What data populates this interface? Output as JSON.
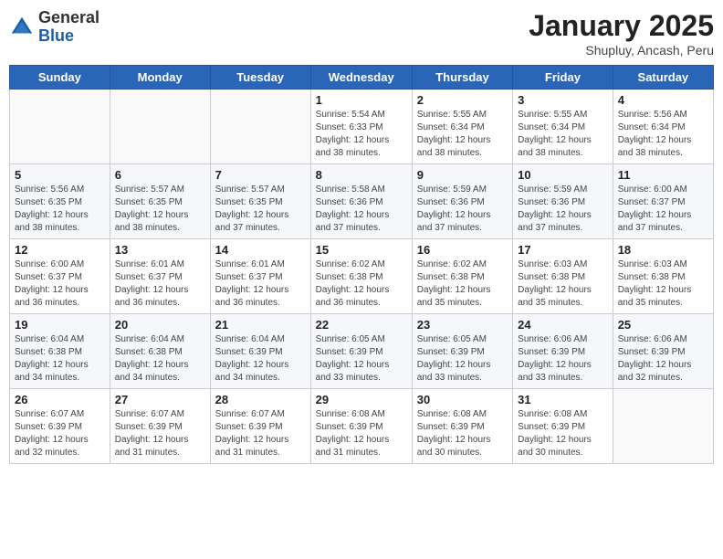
{
  "header": {
    "logo_general": "General",
    "logo_blue": "Blue",
    "month_year": "January 2025",
    "location": "Shupluy, Ancash, Peru"
  },
  "weekdays": [
    "Sunday",
    "Monday",
    "Tuesday",
    "Wednesday",
    "Thursday",
    "Friday",
    "Saturday"
  ],
  "weeks": [
    [
      {
        "day": "",
        "info": ""
      },
      {
        "day": "",
        "info": ""
      },
      {
        "day": "",
        "info": ""
      },
      {
        "day": "1",
        "info": "Sunrise: 5:54 AM\nSunset: 6:33 PM\nDaylight: 12 hours\nand 38 minutes."
      },
      {
        "day": "2",
        "info": "Sunrise: 5:55 AM\nSunset: 6:34 PM\nDaylight: 12 hours\nand 38 minutes."
      },
      {
        "day": "3",
        "info": "Sunrise: 5:55 AM\nSunset: 6:34 PM\nDaylight: 12 hours\nand 38 minutes."
      },
      {
        "day": "4",
        "info": "Sunrise: 5:56 AM\nSunset: 6:34 PM\nDaylight: 12 hours\nand 38 minutes."
      }
    ],
    [
      {
        "day": "5",
        "info": "Sunrise: 5:56 AM\nSunset: 6:35 PM\nDaylight: 12 hours\nand 38 minutes."
      },
      {
        "day": "6",
        "info": "Sunrise: 5:57 AM\nSunset: 6:35 PM\nDaylight: 12 hours\nand 38 minutes."
      },
      {
        "day": "7",
        "info": "Sunrise: 5:57 AM\nSunset: 6:35 PM\nDaylight: 12 hours\nand 37 minutes."
      },
      {
        "day": "8",
        "info": "Sunrise: 5:58 AM\nSunset: 6:36 PM\nDaylight: 12 hours\nand 37 minutes."
      },
      {
        "day": "9",
        "info": "Sunrise: 5:59 AM\nSunset: 6:36 PM\nDaylight: 12 hours\nand 37 minutes."
      },
      {
        "day": "10",
        "info": "Sunrise: 5:59 AM\nSunset: 6:36 PM\nDaylight: 12 hours\nand 37 minutes."
      },
      {
        "day": "11",
        "info": "Sunrise: 6:00 AM\nSunset: 6:37 PM\nDaylight: 12 hours\nand 37 minutes."
      }
    ],
    [
      {
        "day": "12",
        "info": "Sunrise: 6:00 AM\nSunset: 6:37 PM\nDaylight: 12 hours\nand 36 minutes."
      },
      {
        "day": "13",
        "info": "Sunrise: 6:01 AM\nSunset: 6:37 PM\nDaylight: 12 hours\nand 36 minutes."
      },
      {
        "day": "14",
        "info": "Sunrise: 6:01 AM\nSunset: 6:37 PM\nDaylight: 12 hours\nand 36 minutes."
      },
      {
        "day": "15",
        "info": "Sunrise: 6:02 AM\nSunset: 6:38 PM\nDaylight: 12 hours\nand 36 minutes."
      },
      {
        "day": "16",
        "info": "Sunrise: 6:02 AM\nSunset: 6:38 PM\nDaylight: 12 hours\nand 35 minutes."
      },
      {
        "day": "17",
        "info": "Sunrise: 6:03 AM\nSunset: 6:38 PM\nDaylight: 12 hours\nand 35 minutes."
      },
      {
        "day": "18",
        "info": "Sunrise: 6:03 AM\nSunset: 6:38 PM\nDaylight: 12 hours\nand 35 minutes."
      }
    ],
    [
      {
        "day": "19",
        "info": "Sunrise: 6:04 AM\nSunset: 6:38 PM\nDaylight: 12 hours\nand 34 minutes."
      },
      {
        "day": "20",
        "info": "Sunrise: 6:04 AM\nSunset: 6:38 PM\nDaylight: 12 hours\nand 34 minutes."
      },
      {
        "day": "21",
        "info": "Sunrise: 6:04 AM\nSunset: 6:39 PM\nDaylight: 12 hours\nand 34 minutes."
      },
      {
        "day": "22",
        "info": "Sunrise: 6:05 AM\nSunset: 6:39 PM\nDaylight: 12 hours\nand 33 minutes."
      },
      {
        "day": "23",
        "info": "Sunrise: 6:05 AM\nSunset: 6:39 PM\nDaylight: 12 hours\nand 33 minutes."
      },
      {
        "day": "24",
        "info": "Sunrise: 6:06 AM\nSunset: 6:39 PM\nDaylight: 12 hours\nand 33 minutes."
      },
      {
        "day": "25",
        "info": "Sunrise: 6:06 AM\nSunset: 6:39 PM\nDaylight: 12 hours\nand 32 minutes."
      }
    ],
    [
      {
        "day": "26",
        "info": "Sunrise: 6:07 AM\nSunset: 6:39 PM\nDaylight: 12 hours\nand 32 minutes."
      },
      {
        "day": "27",
        "info": "Sunrise: 6:07 AM\nSunset: 6:39 PM\nDaylight: 12 hours\nand 31 minutes."
      },
      {
        "day": "28",
        "info": "Sunrise: 6:07 AM\nSunset: 6:39 PM\nDaylight: 12 hours\nand 31 minutes."
      },
      {
        "day": "29",
        "info": "Sunrise: 6:08 AM\nSunset: 6:39 PM\nDaylight: 12 hours\nand 31 minutes."
      },
      {
        "day": "30",
        "info": "Sunrise: 6:08 AM\nSunset: 6:39 PM\nDaylight: 12 hours\nand 30 minutes."
      },
      {
        "day": "31",
        "info": "Sunrise: 6:08 AM\nSunset: 6:39 PM\nDaylight: 12 hours\nand 30 minutes."
      },
      {
        "day": "",
        "info": ""
      }
    ]
  ]
}
